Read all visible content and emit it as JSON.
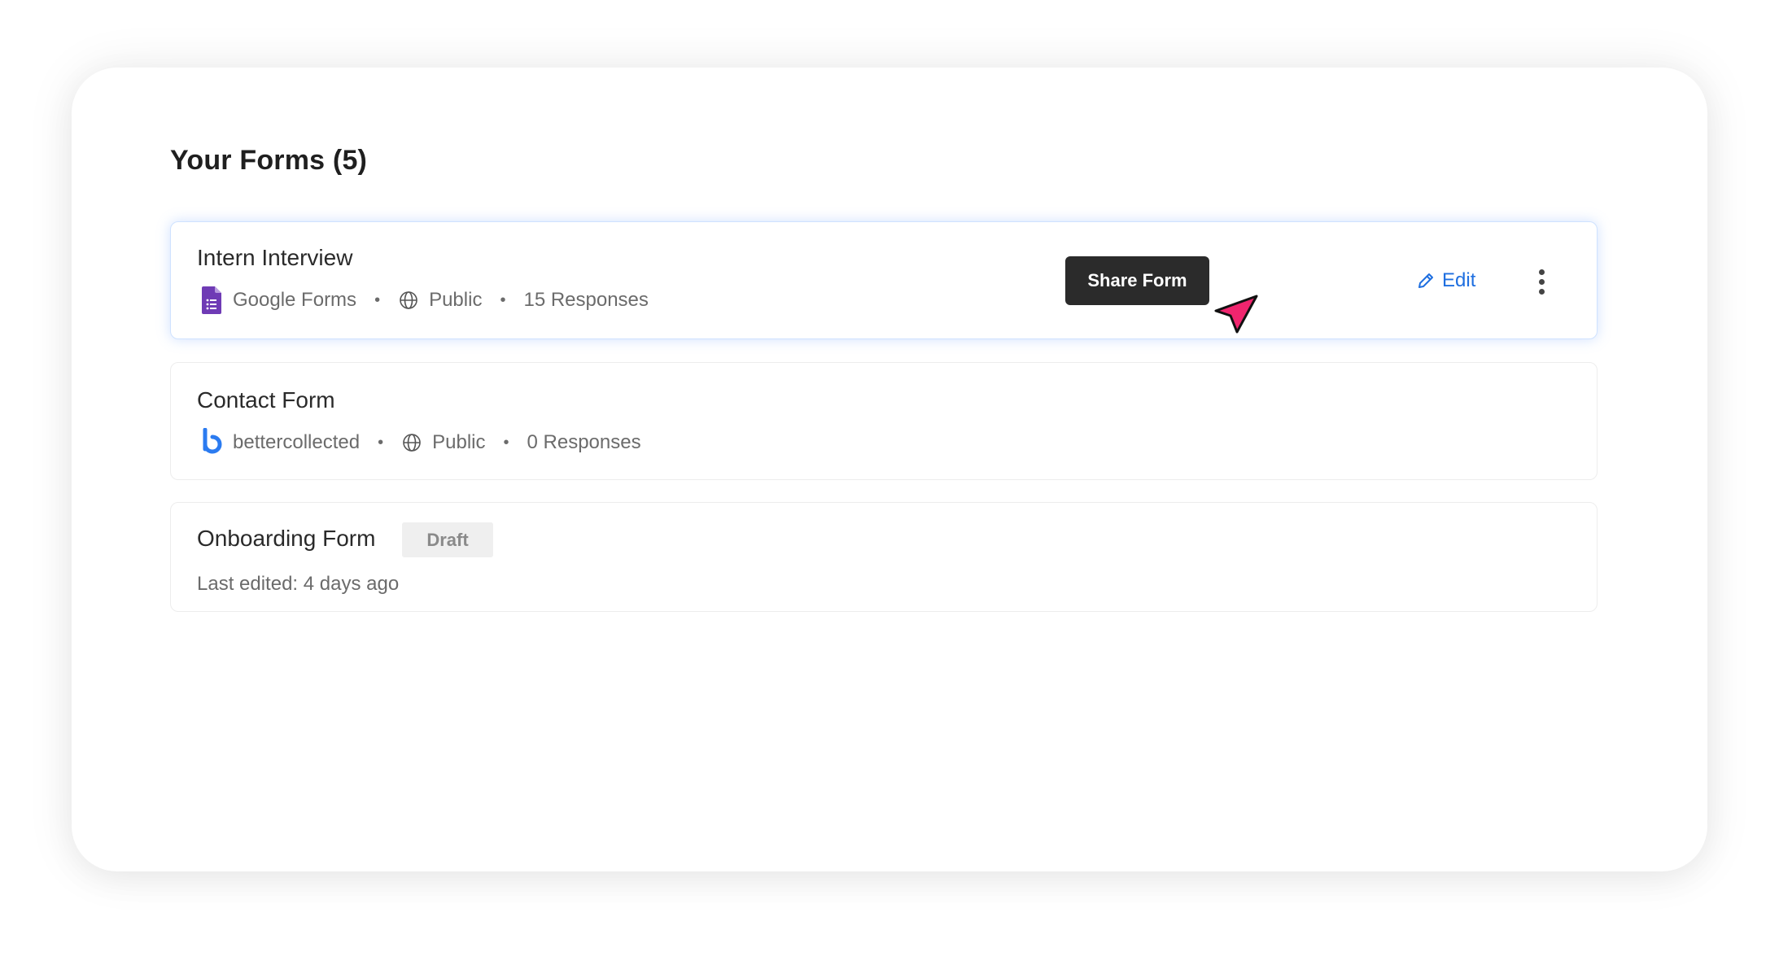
{
  "page": {
    "title": "Your Forms (5)"
  },
  "colors": {
    "accent": "#1f6fe0",
    "tooltip_bg": "#2b2b2b",
    "cursor": "#f0256e",
    "google_forms": "#6f3bb5",
    "bettercollected": "#2b7bf0"
  },
  "forms": [
    {
      "title": "Intern Interview",
      "provider": "Google Forms",
      "provider_icon": "google-forms-icon",
      "visibility": "Public",
      "visibility_icon": "globe-icon",
      "responses": "15 Responses"
    },
    {
      "title": "Contact Form",
      "provider": "bettercollected",
      "provider_icon": "bettercollected-logo-icon",
      "visibility": "Public",
      "visibility_icon": "globe-icon",
      "responses": "0 Responses"
    },
    {
      "title": "Onboarding Form",
      "badge": "Draft",
      "last_edited": "Last edited: 4 days ago"
    }
  ],
  "actions": {
    "tooltip": "Share Form",
    "edit_label": "Edit",
    "edit_icon": "pencil-icon",
    "more_icon": "more-vertical-icon"
  }
}
